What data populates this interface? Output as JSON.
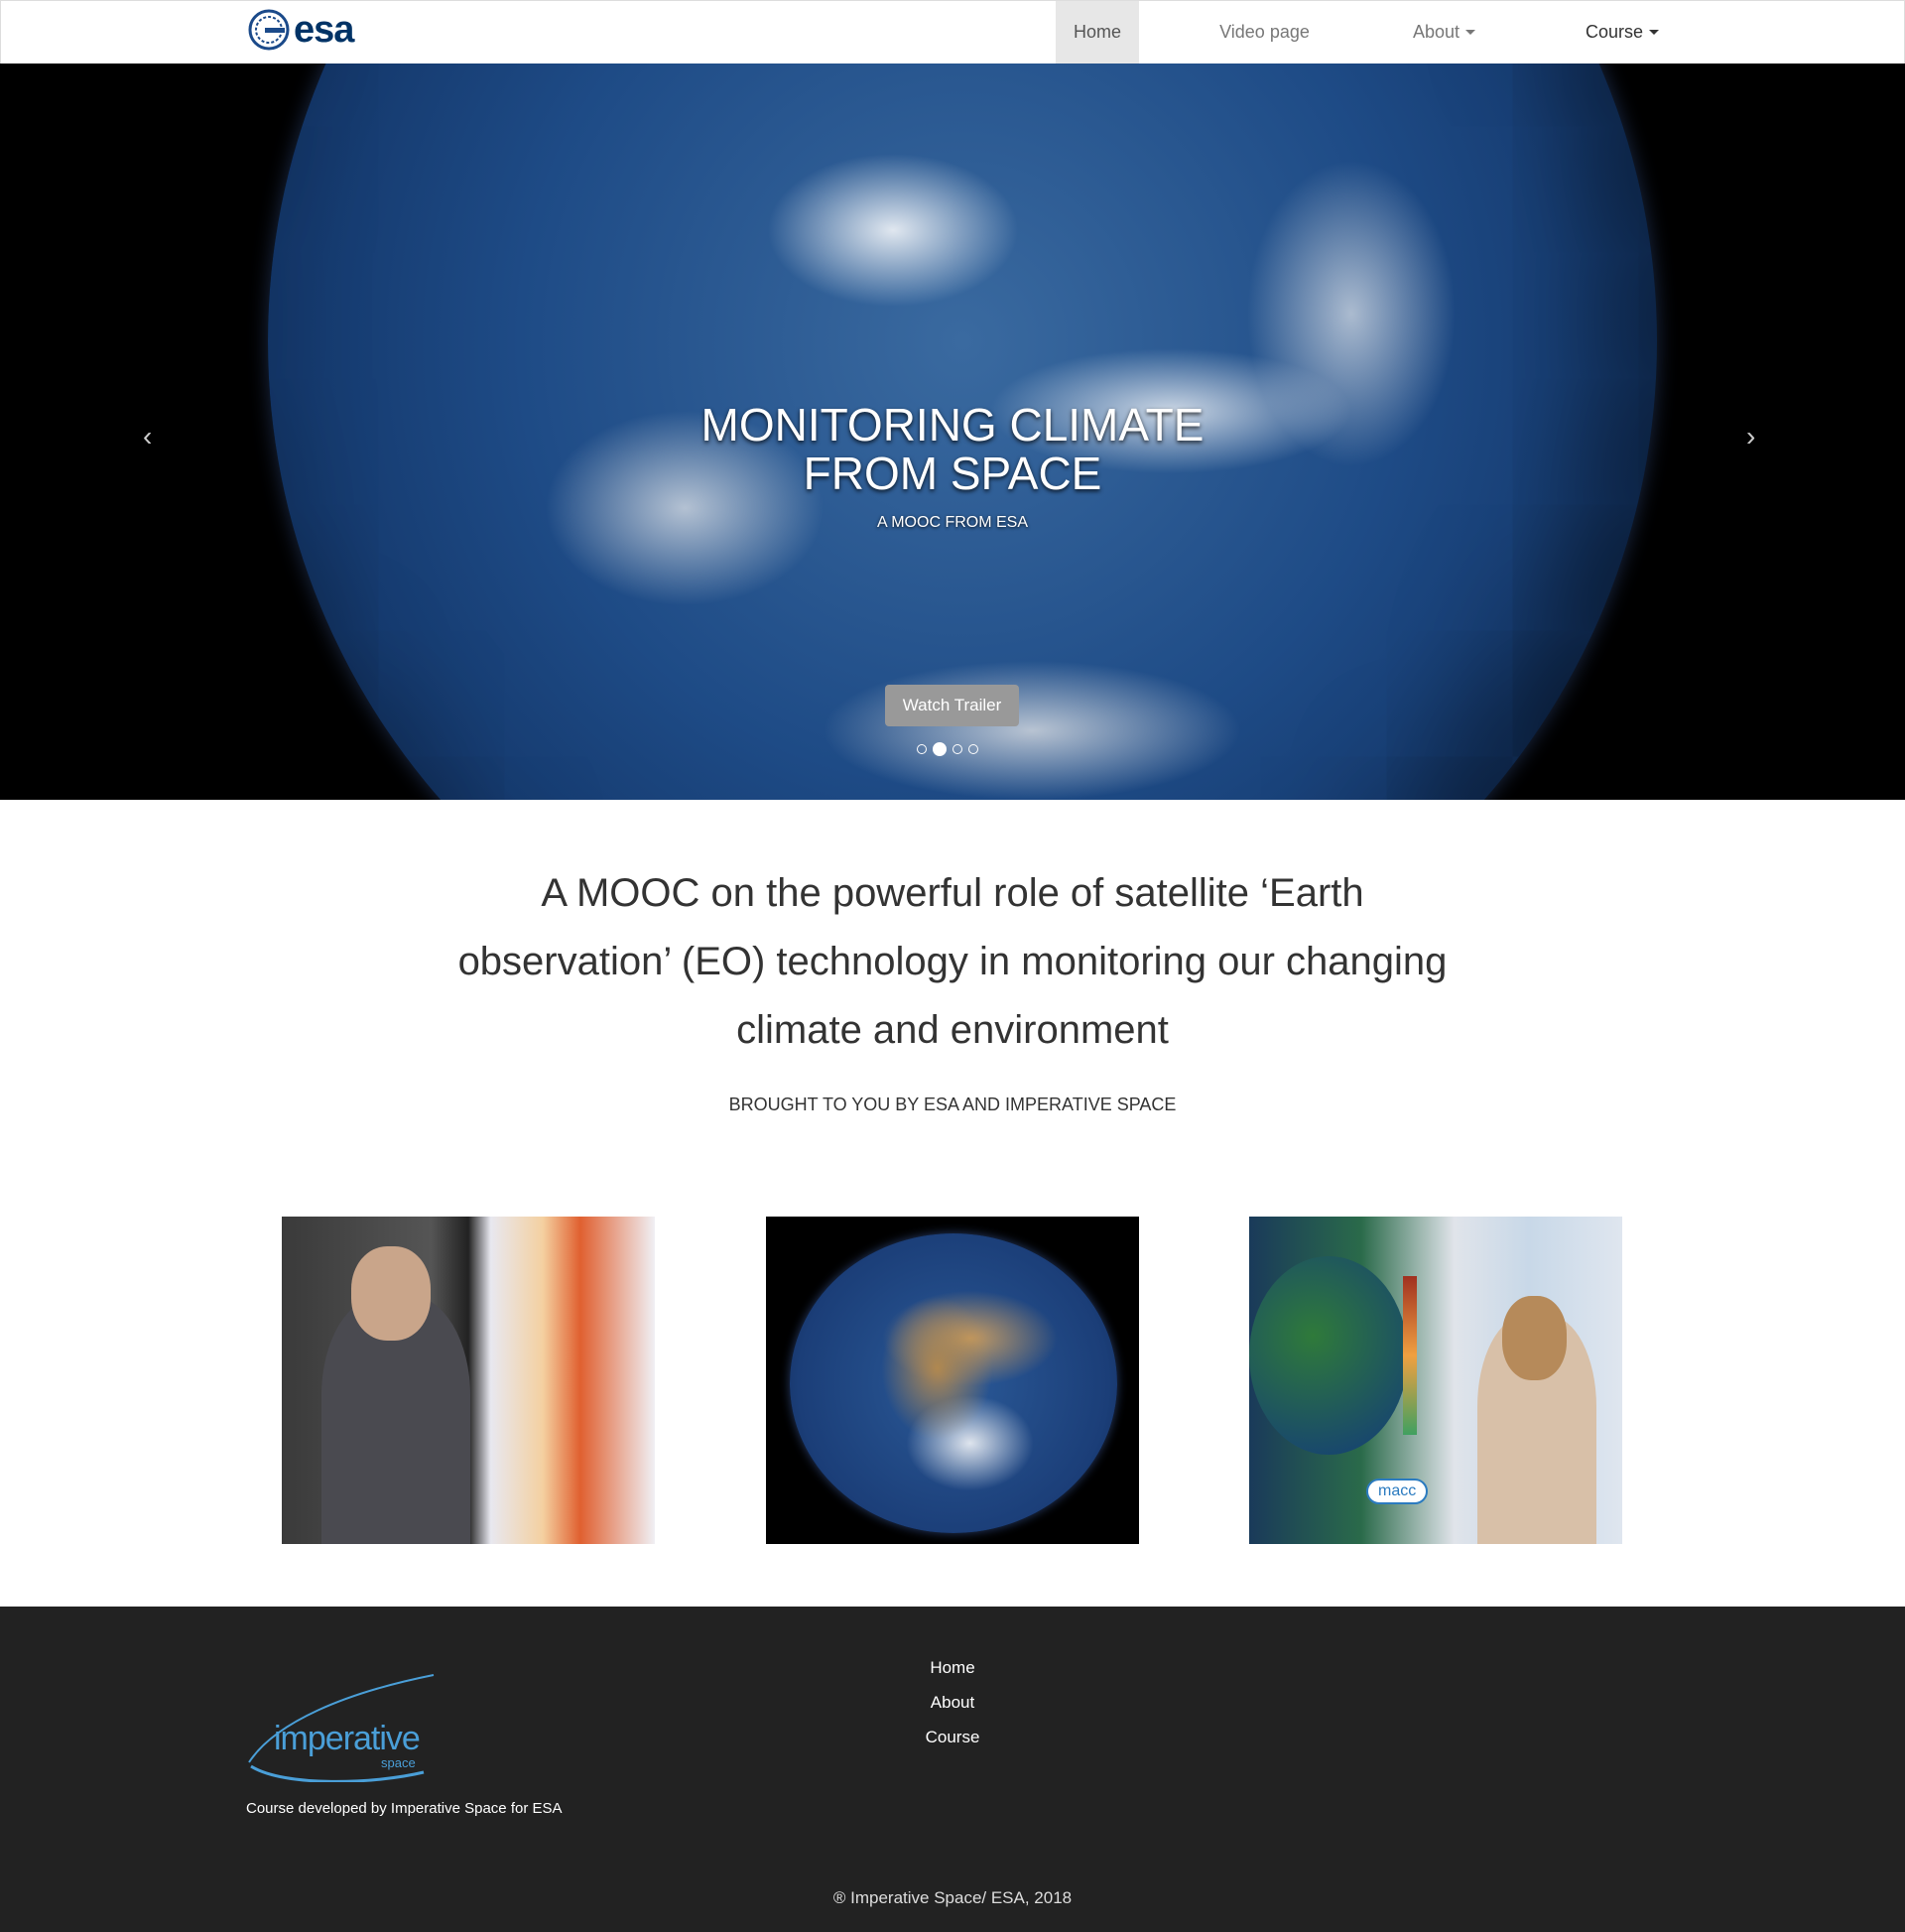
{
  "header": {
    "logo_text": "esa",
    "nav": [
      {
        "label": "Home"
      },
      {
        "label": "Video page"
      },
      {
        "label": "About"
      },
      {
        "label": "Course"
      }
    ]
  },
  "hero": {
    "title_line1": "MONITORING CLIMATE",
    "title_line2": "FROM SPACE",
    "subtitle": "A MOOC FROM ESA",
    "button": "Watch Trailer",
    "prev": "‹",
    "next": "›",
    "slide_count": 4,
    "active_slide": 2
  },
  "intro": {
    "lead": "A MOOC on the powerful role of satellite ‘Earth observation’ (EO) technology in monitoring our changing climate and environment",
    "byline": "BROUGHT TO YOU BY ESA AND IMPERATIVE SPACE"
  },
  "thumbnails": {
    "macc_label": "macc"
  },
  "footer": {
    "logo_text": "imperative",
    "logo_sub": "space",
    "tagline": "Course developed by Imperative Space for ESA",
    "links": [
      {
        "label": "Home"
      },
      {
        "label": "About"
      },
      {
        "label": "Course"
      }
    ],
    "copyright": "® Imperative Space/ ESA, 2018"
  }
}
